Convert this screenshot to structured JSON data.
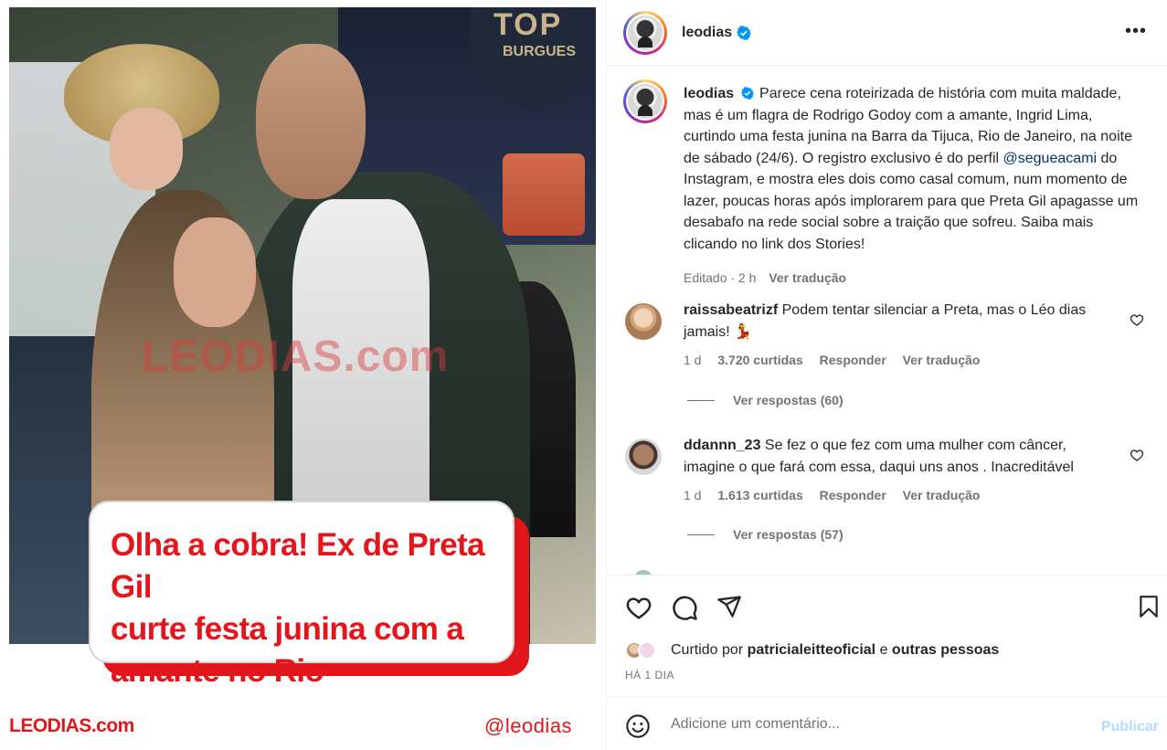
{
  "post_image": {
    "headline": "Olha a cobra! Ex de Preta Gil curte festa junina com a amante no Rio",
    "headline_lines": [
      "Olha a cobra! Ex de Preta Gil",
      "curte festa junina com a",
      "amante no Rio"
    ],
    "watermark": "LEODIAS.com",
    "brand_left": "LEODIAS.com",
    "brand_right": "@leodias",
    "sign_text": "TOP",
    "sign_sub": "BURGUES"
  },
  "header": {
    "username": "leodias",
    "verified": true,
    "more_icon": "more-horizontal-icon"
  },
  "caption": {
    "username": "leodias",
    "text_before_mention": "Parece cena roteirizada de história com muita maldade, mas é um flagra de Rodrigo Godoy com a amante, Ingrid Lima, curtindo uma festa junina na Barra da Tijuca, Rio de Janeiro, na noite de sábado (24/6). O registro exclusivo é do perfil ",
    "mention": "@segueacami",
    "text_after_mention": " do Instagram, e mostra eles dois como casal comum, num momento de lazer, poucas horas após implorarem para que Preta Gil apagasse um desabafo na rede social sobre a traição que sofreu. Saiba mais clicando no link dos Stories!",
    "edited": "Editado · 2 h",
    "translate": "Ver tradução"
  },
  "comments": [
    {
      "username": "raissabeatrizf",
      "text": "Podem tentar silenciar a Preta, mas o Léo dias jamais! 💃",
      "time": "1 d",
      "likes": "3.720 curtidas",
      "reply": "Responder",
      "translate": "Ver tradução",
      "view_replies": "Ver respostas (60)"
    },
    {
      "username": "ddannn_23",
      "text": "Se fez o que fez com uma mulher com câncer, imagine o que fará com essa, daqui uns anos . Inacreditável",
      "time": "1 d",
      "likes": "1.613 curtidas",
      "reply": "Responder",
      "translate": "Ver tradução",
      "view_replies": "Ver respostas (57)"
    }
  ],
  "actions": {
    "like_icon": "heart-icon",
    "comment_icon": "comment-icon",
    "share_icon": "send-icon",
    "save_icon": "bookmark-icon"
  },
  "likes": {
    "prefix": "Curtido por",
    "user": "patricialeitteoficial",
    "connector": "e",
    "others": "outras pessoas",
    "ago": "HÁ 1 DIA"
  },
  "add_comment": {
    "placeholder": "Adicione um comentário...",
    "publish": "Publicar"
  },
  "colors": {
    "brand_red": "#e0161b",
    "link_blue": "#00376b",
    "verified_blue": "#0095f6",
    "muted": "#737373",
    "publish_disabled": "#b3dbff"
  }
}
